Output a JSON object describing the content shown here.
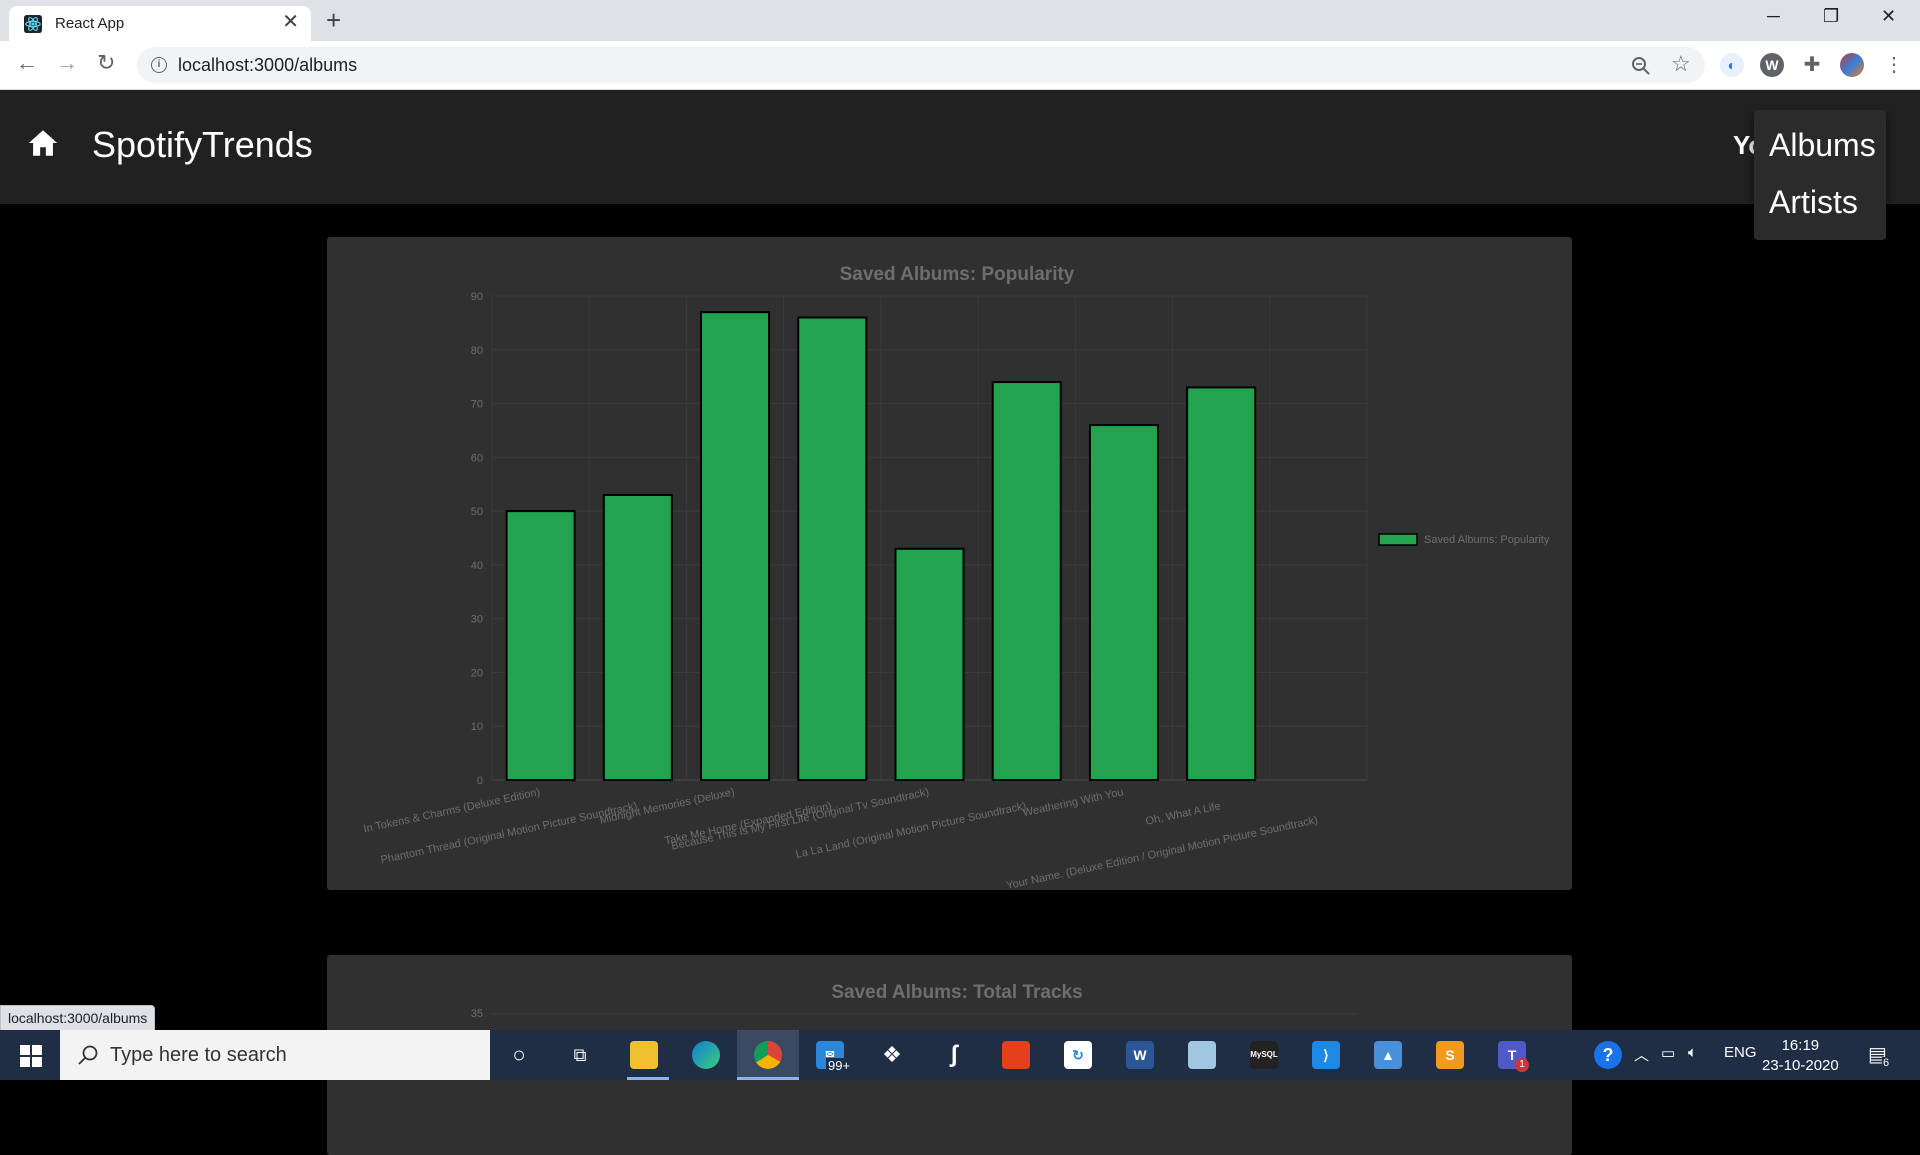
{
  "browser": {
    "tab_title": "React App",
    "tab_close": "✕",
    "new_tab": "+",
    "url": "localhost:3000/albums",
    "status_url": "localhost:3000/albums",
    "window_controls": [
      "─",
      "❐",
      "✕"
    ]
  },
  "app": {
    "brand": "SpotifyTrends",
    "header_partial": "Yo",
    "menu_items": [
      "Albums",
      "Artists"
    ]
  },
  "charts": {
    "popularity_title": "Saved Albums: Popularity",
    "tracks_title": "Saved Albums: Total Tracks",
    "tracks_top_tick": "35"
  },
  "chart_data": [
    {
      "type": "bar",
      "title": "Saved Albums: Popularity",
      "categories": [
        "In Tokens & Charms (Deluxe Edition)",
        "Phantom Thread (Original Motion Picture Soundtrack)",
        "Midnight Memories (Deluxe)",
        "Take Me Home (Expanded Edition)",
        "Because This Is My First Life (Original Tv Soundtrack)",
        "La La Land (Original Motion Picture Soundtrack)",
        "Weathering With You",
        "Oh, What A Life",
        "Your Name. (Deluxe Edition / Original Motion Picture Soundtrack)"
      ],
      "series": [
        {
          "name": "Saved Albums: Popularity",
          "values": [
            50,
            53,
            87,
            86,
            43,
            74,
            66,
            73,
            0
          ]
        }
      ],
      "ylim": [
        0,
        90
      ],
      "yticks": [
        0,
        10,
        20,
        30,
        40,
        50,
        60,
        70,
        80,
        90
      ],
      "legend_position": "right",
      "grid": true,
      "bar_color": "#21a350"
    }
  ],
  "taskbar": {
    "search_placeholder": "Type here to search",
    "mail_badge": "99+",
    "teams_badge": "1",
    "lang": "ENG",
    "time": "16:19",
    "date": "23-10-2020",
    "notification_count": "6"
  }
}
